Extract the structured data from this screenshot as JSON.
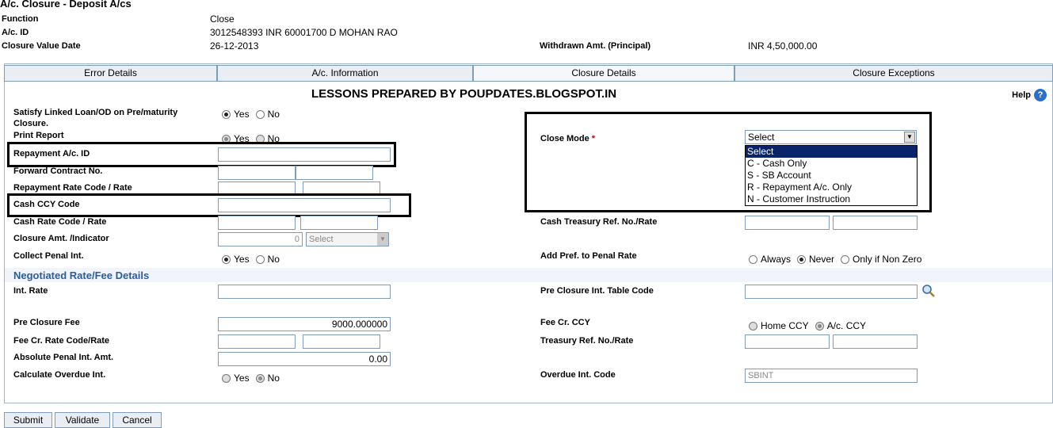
{
  "header": {
    "title": "A/c. Closure - Deposit A/cs",
    "function_label": "Function",
    "function_value": "Close",
    "acid_label": "A/c. ID",
    "acid_value": "3012548393  INR  60001700  D MOHAN RAO",
    "cvd_label": "Closure Value Date",
    "cvd_value": "26-12-2013",
    "withdrawn_label": "Withdrawn Amt. (Principal)",
    "withdrawn_value": "INR  4,50,000.00"
  },
  "tabs": [
    {
      "label": "Error Details"
    },
    {
      "label": "A/c. Information"
    },
    {
      "label": "Closure Details"
    },
    {
      "label": "Closure Exceptions"
    }
  ],
  "banner": "LESSONS PREPARED BY POUPDATES.BLOGSPOT.IN",
  "help": "Help",
  "form": {
    "satisfy_label": "Satisfy Linked Loan/OD on Pre/maturity Closure.",
    "print_label": "Print Report",
    "yes": "Yes",
    "no": "No",
    "repay_acid_label": "Repayment A/c. ID",
    "fwd_label": "Forward Contract No.",
    "repay_rate_label": "Repayment Rate Code / Rate",
    "cash_ccy_label": "Cash CCY Code",
    "cash_rate_label": "Cash Rate Code / Rate",
    "closure_amt_label": "Closure Amt. /Indicator",
    "closure_amt_value": "0",
    "closure_ind_value": "Select",
    "collect_penal_label": "Collect Penal Int.",
    "close_mode_label": "Close Mode",
    "close_mode_star": "*",
    "close_mode_value": "Select",
    "close_mode_options": [
      "Select",
      "C - Cash Only",
      "S - SB Account",
      "R - Repayment A/c. Only",
      "N - Customer Instruction"
    ],
    "cash_treasury_label": "Cash Treasury Ref. No./Rate",
    "add_pref_label": "Add Pref. to Penal Rate",
    "always": "Always",
    "never": "Never",
    "nonzero": "Only if Non Zero",
    "section": "Negotiated Rate/Fee Details",
    "int_rate_label": "Int. Rate",
    "pre_table_label": "Pre Closure Int. Table Code",
    "pre_fee_label": "Pre Closure Fee",
    "pre_fee_value": "9000.000000",
    "fee_ccy_label": "Fee Cr. CCY",
    "home_ccy": "Home CCY",
    "ac_ccy": "A/c. CCY",
    "fee_rate_label": "Fee Cr. Rate Code/Rate",
    "treasury_label": "Treasury Ref. No./Rate",
    "abs_penal_label": "Absolute Penal Int. Amt.",
    "abs_penal_value": "0.00",
    "calc_overdue_label": "Calculate Overdue Int.",
    "overdue_code_label": "Overdue Int. Code",
    "overdue_code_value": "SBINT"
  },
  "buttons": {
    "submit": "Submit",
    "validate": "Validate",
    "cancel": "Cancel"
  }
}
